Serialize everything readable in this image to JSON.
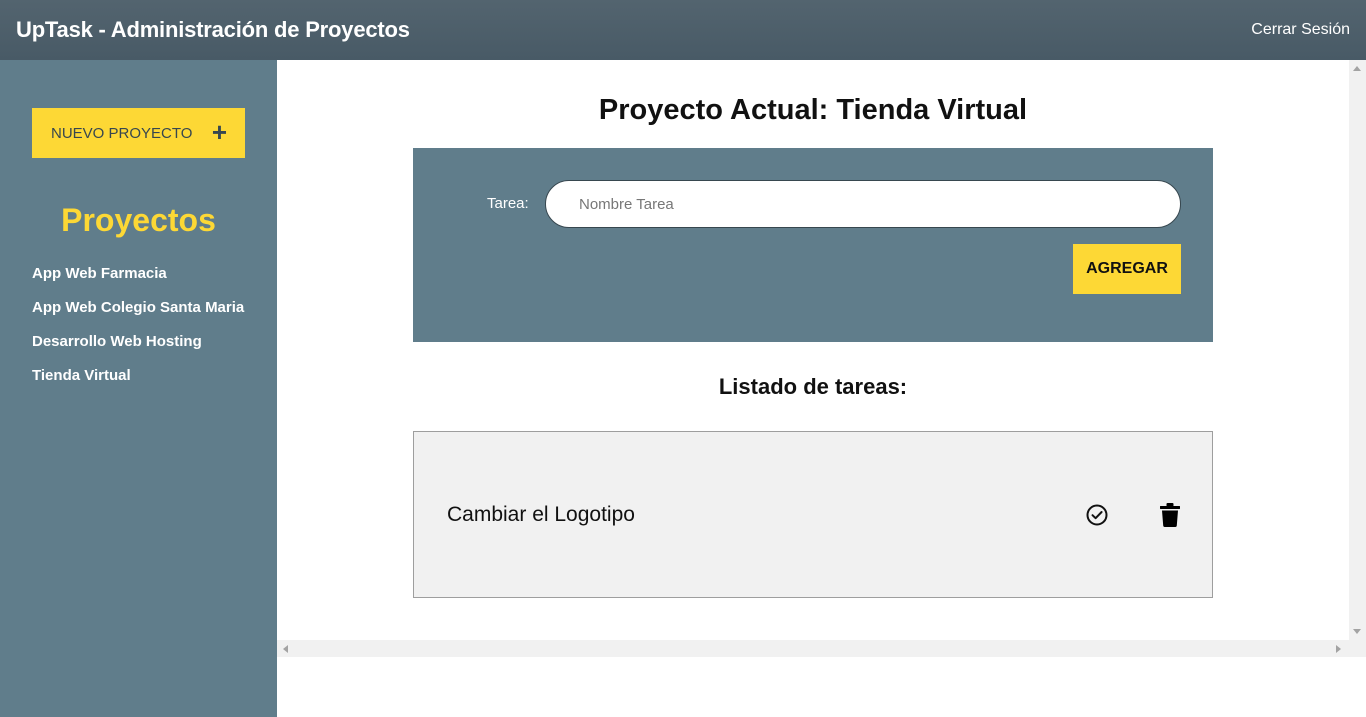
{
  "header": {
    "title": "UpTask - Administración de Proyectos",
    "logout_label": "Cerrar Sesión"
  },
  "sidebar": {
    "new_project_label": "NUEVO PROYECTO",
    "new_project_icon": "plus-icon",
    "projects_title": "Proyectos",
    "projects": [
      {
        "label": "App Web Farmacia"
      },
      {
        "label": "App Web Colegio Santa Maria"
      },
      {
        "label": "Desarrollo Web Hosting"
      },
      {
        "label": "Tienda Virtual"
      }
    ]
  },
  "main": {
    "current_project_label": "Proyecto Actual:",
    "current_project_name": "Tienda Virtual",
    "form": {
      "task_label": "Tarea:",
      "task_placeholder": "Nombre Tarea",
      "task_value": "",
      "add_button_label": "AGREGAR"
    },
    "list_title": "Listado de tareas:",
    "tasks": [
      {
        "name": "Cambiar el Logotipo",
        "complete_icon": "check-circle-icon",
        "delete_icon": "trash-icon"
      }
    ]
  },
  "colors": {
    "topbar": "#485a66",
    "sidebar": "#607d8b",
    "accent": "#fdd835",
    "form_bg": "#607d8b",
    "task_bg": "#f1f1f1"
  }
}
